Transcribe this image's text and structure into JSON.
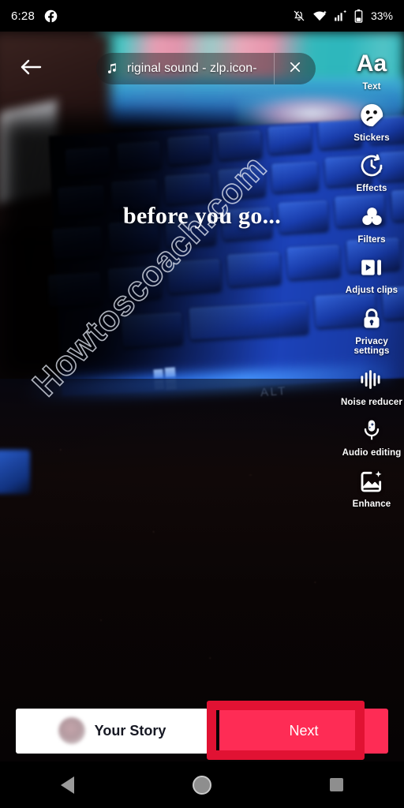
{
  "status_bar": {
    "time": "6:28",
    "app_icon": "facebook-icon",
    "icons": [
      "notifications-off-icon",
      "wifi-icon",
      "cell-signal-icon",
      "battery-icon"
    ],
    "battery": "33%"
  },
  "editor": {
    "back_icon": "back-arrow-icon",
    "sound": {
      "music_icon": "music-note-icon",
      "title": "riginal sound - zlp.icon-",
      "close_icon": "close-x-icon"
    },
    "overlay_text": "before you go...",
    "watermark": "Howtoscoach.com",
    "background_labels": {
      "alt_key": "ALT",
      "windows_key": "windows-logo-key"
    },
    "tools": [
      {
        "label": "Text",
        "icon": "text-aa-icon",
        "glyph": "Aa"
      },
      {
        "label": "Stickers",
        "icon": "sticker-smiley-icon"
      },
      {
        "label": "Effects",
        "icon": "effects-clock-icon"
      },
      {
        "label": "Filters",
        "icon": "filters-circles-icon"
      },
      {
        "label": "Adjust clips",
        "icon": "adjust-clips-icon"
      },
      {
        "label": "Privacy settings",
        "icon": "privacy-lock-icon"
      },
      {
        "label": "Noise reducer",
        "icon": "noise-reducer-waveform-icon"
      },
      {
        "label": "Audio editing",
        "icon": "audio-editing-mic-icon"
      },
      {
        "label": "Enhance",
        "icon": "enhance-image-sparkle-icon"
      }
    ]
  },
  "bottom_bar": {
    "your_story_label": "Your Story",
    "avatar": "user-avatar",
    "next_label": "Next",
    "highlight_box": "annotation-highlight"
  },
  "nav_bar": {
    "back": "nav-back-icon",
    "home": "nav-home-icon",
    "recents": "nav-recents-icon"
  },
  "colors": {
    "accent_pink": "#fe2c55",
    "highlight_red": "#e11233",
    "button_white": "#ffffff",
    "status_black": "#000000",
    "keyboard_blue": "#1c42b9"
  }
}
